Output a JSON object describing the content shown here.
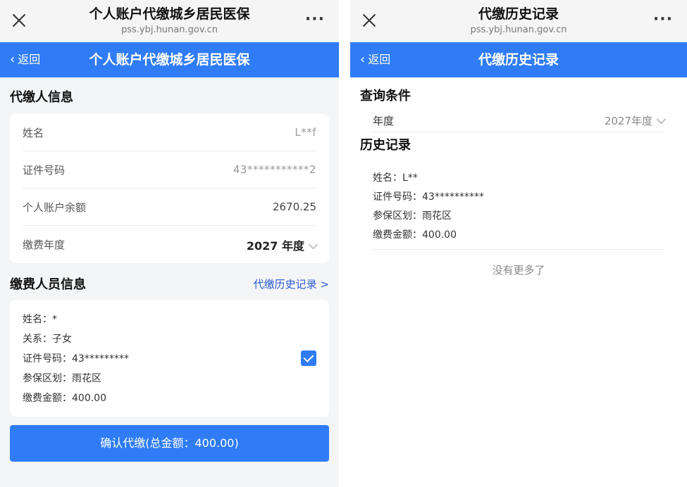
{
  "left": {
    "browser": {
      "title": "个人账户代缴城乡居民医保",
      "url": "pss.ybj.hunan.gov.cn",
      "more": "···"
    },
    "nav": {
      "back": "返回",
      "title": "个人账户代缴城乡居民医保"
    },
    "payer_section": {
      "title": "代缴人信息",
      "rows": [
        {
          "label": "姓名",
          "value": "L**f"
        },
        {
          "label": "证件号码",
          "value": "43***********2"
        },
        {
          "label": "个人账户余额",
          "value": "2670.25"
        },
        {
          "label": "缴费年度",
          "value": "2027 年度"
        }
      ]
    },
    "member_section": {
      "title": "缴费人员信息",
      "history_link": "代缴历史记录 >",
      "lines": [
        "姓名：*",
        "关系：子女",
        "证件号码：43*********",
        "参保区划：雨花区",
        "缴费金额：400.00"
      ],
      "checked": true
    },
    "confirm_button": "确认代缴(总金额：400.00)"
  },
  "right": {
    "browser": {
      "title": "代缴历史记录",
      "url": "pss.ybj.hunan.gov.cn",
      "more": "···"
    },
    "nav": {
      "back": "返回",
      "title": "代缴历史记录"
    },
    "query": {
      "title": "查询条件",
      "year_label": "年度",
      "year_value": "2027年度"
    },
    "history": {
      "title": "历史记录",
      "record_lines": [
        "姓名：L**",
        "证件号码：43**********",
        "参保区划：雨花区",
        "缴费金额：400.00"
      ],
      "no_more": "没有更多了"
    }
  },
  "colors": {
    "accent": "#2f7cf6",
    "link": "#2a5bd7",
    "page_bg": "#f4f5f7"
  }
}
